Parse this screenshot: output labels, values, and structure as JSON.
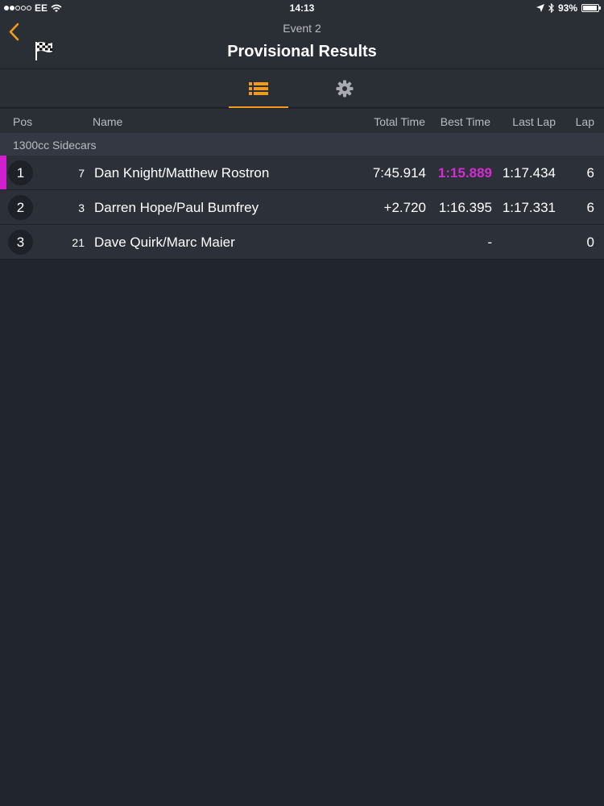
{
  "status_bar": {
    "carrier": "EE",
    "time": "14:13",
    "battery": "93%",
    "battery_level": 0.93
  },
  "nav": {
    "subtitle": "Event 2",
    "title": "Provisional Results"
  },
  "colors": {
    "accent": "#f29a1f",
    "fastest": "#d52bd3"
  },
  "tabs": [
    {
      "icon": "list-icon",
      "active": true
    },
    {
      "icon": "gear-icon",
      "active": false
    }
  ],
  "table": {
    "headers": {
      "pos": "Pos",
      "name": "Name",
      "total": "Total Time",
      "best": "Best Time",
      "last": "Last Lap",
      "lap": "Lap"
    },
    "class_name": "1300cc Sidecars",
    "rows": [
      {
        "pos": "1",
        "number": "7",
        "name": "Dan Knight/Matthew Rostron",
        "total": "7:45.914",
        "best": "1:15.889",
        "last": "1:17.434",
        "lap": "6"
      },
      {
        "pos": "2",
        "number": "3",
        "name": "Darren Hope/Paul Bumfrey",
        "total": "+2.720",
        "best": "1:16.395",
        "last": "1:17.331",
        "lap": "6"
      },
      {
        "pos": "3",
        "number": "21",
        "name": "Dave Quirk/Marc Maier",
        "total": "",
        "best": "-",
        "last": "",
        "lap": "0"
      }
    ]
  }
}
